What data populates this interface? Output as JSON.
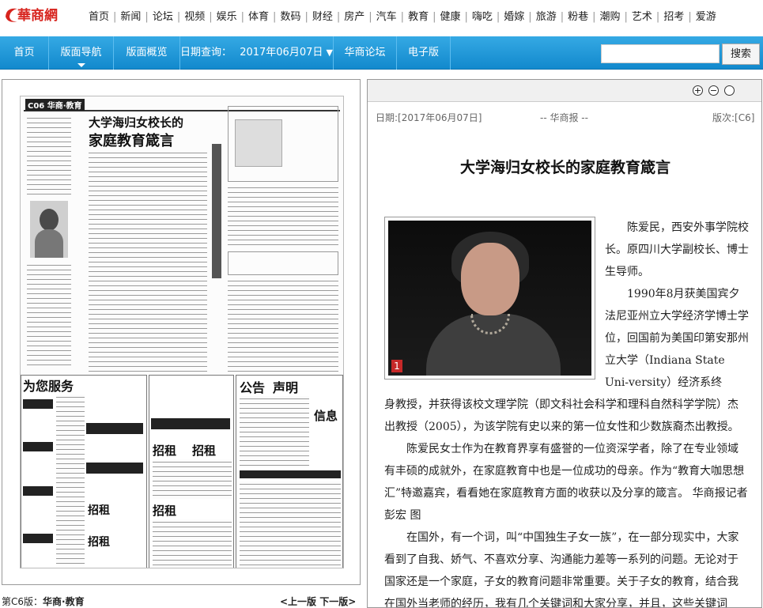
{
  "site": {
    "logo_text": "華商網"
  },
  "channels": [
    "首页",
    "新闻",
    "论坛",
    "视频",
    "娱乐",
    "体育",
    "数码",
    "财经",
    "房产",
    "汽车",
    "教育",
    "健康",
    "嗨吃",
    "婚嫁",
    "旅游",
    "粉巷",
    "潮购",
    "艺术",
    "招考",
    "爱游"
  ],
  "nav": {
    "home": "首页",
    "layout_nav": "版面导航",
    "layout_overview": "版面概览",
    "date_label": "日期查询：",
    "date_value": "2017年06月07日",
    "forum": "华商论坛",
    "epaper": "电子版",
    "search_placeholder": "",
    "search_button": "搜索"
  },
  "newspaper": {
    "page_code": "C06 华商·教育",
    "headline_line1": "大学海归女校长的",
    "headline_line2": "家庭教育箴言",
    "ad_service": "为您服务",
    "ad_rent": "招租",
    "ad_notice": "公告",
    "ad_statement": "声明",
    "ad_info": "信息"
  },
  "left_footer": {
    "edition_prefix": "第C6版：",
    "edition_name": "华商·教育",
    "pager": "<上一版 下一版>"
  },
  "article": {
    "toolbar": {
      "zoom_in": "+",
      "zoom_out": "−",
      "reset": ""
    },
    "date": "日期:[2017年06月07日]",
    "source": "-- 华商报 --",
    "edition": "版次:[C6]",
    "title": "大学海归女校长的家庭教育箴言",
    "photo_number": "1",
    "para_side": "陈爱民，西安外事学院校长。原四川大学副校长、博士生导师。",
    "para_side2": "1990年8月获美国宾夕法尼亚州立大学经济学博士学位，回国前为美国印第安那州立大学（Indiana State Uni-versity）经济系终",
    "para_cont": "身教授，并获得该校文理学院（即文科社会科学和理科自然科学学院）杰出教授（2005），为该学院有史以来的第一位女性和少数族裔杰出教授。",
    "para_2": "陈爱民女士作为在教育界享有盛誉的一位资深学者，除了在专业领域有丰硕的成就外，在家庭教育中也是一位成功的母亲。作为“教育大咖思想汇”特邀嘉宾，看看她在家庭教育方面的收获以及分享的箴言。 华商报记者 彭宏 图",
    "para_3": "在国外，有一个词，叫“中国独生子女一族”，在一部分现实中，大家看到了自我、娇气、不喜欢分享、沟通能力差等一系列的问题。无论对于国家还是一个家庭，子女的教育问题非常重要。关于子女的教育，结合我在国外当老师的经历，我有几个关键词和大家分享，并且，这些关键词"
  }
}
